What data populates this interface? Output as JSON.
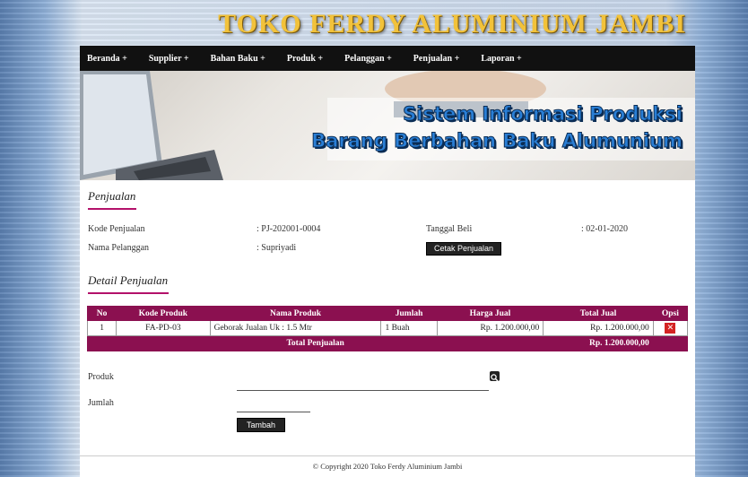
{
  "site": {
    "title": "TOKO FERDY ALUMINIUM JAMBI"
  },
  "nav": {
    "items": [
      "Beranda +",
      "Supplier +",
      "Bahan Baku +",
      "Produk +",
      "Pelanggan +",
      "Penjualan +",
      "Laporan +"
    ]
  },
  "banner": {
    "line1": "Sistem Informasi Produksi",
    "line2": "Barang Berbahan Baku Alumunium"
  },
  "penjualan": {
    "title": "Penjualan",
    "kode_label": "Kode Penjualan",
    "kode_value": ": PJ-202001-0004",
    "nama_label": "Nama Pelanggan",
    "nama_value": ": Supriyadi",
    "tanggal_label": "Tanggal Beli",
    "tanggal_value": ": 02-01-2020",
    "cetak_button": "Cetak Penjualan"
  },
  "detail": {
    "title": "Detail Penjualan",
    "headers": [
      "No",
      "Kode Produk",
      "Nama Produk",
      "Jumlah",
      "Harga Jual",
      "Total Jual",
      "Opsi"
    ],
    "rows": [
      {
        "no": "1",
        "kode": "FA-PD-03",
        "nama": "Geborak Jualan Uk : 1.5 Mtr",
        "jumlah": "1 Buah",
        "harga": "Rp. 1.200.000,00",
        "total": "Rp. 1.200.000,00",
        "opsi": "✕"
      }
    ],
    "total_label": "Total Penjualan",
    "total_value": "Rp. 1.200.000,00"
  },
  "form": {
    "produk_label": "Produk",
    "jumlah_label": "Jumlah",
    "tambah_button": "Tambah"
  },
  "footer": {
    "text": "© Copyright 2020 Toko Ferdy Aluminium Jambi"
  },
  "colors": {
    "accent": "#8b1050",
    "title_gold": "#f2c23a",
    "nav_bg": "#111111"
  }
}
